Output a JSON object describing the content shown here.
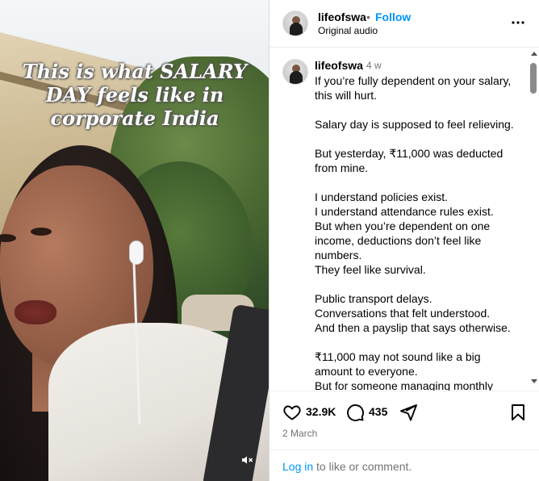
{
  "media": {
    "overlay_text": "This is what SALARY DAY feels like in corporate India",
    "mute_icon": "speaker-muted-icon"
  },
  "header": {
    "username": "lifeofswa",
    "separator": "•",
    "follow_label": "Follow",
    "audio": "Original audio",
    "more_icon": "more-horizontal-icon"
  },
  "caption": {
    "username": "lifeofswa",
    "time": "4 w",
    "text": "If you’re fully dependent on your salary,\nthis will hurt.\n\nSalary day is supposed to feel relieving.\n\nBut yesterday, ₹11,000 was deducted\nfrom mine.\n\nI understand policies exist.\nI understand attendance rules exist.\nBut when you’re dependent on one\nincome, deductions don’t feel like\nnumbers.\nThey feel like survival.\n\nPublic transport delays.\nConversations that felt understood.\nAnd then a payslip that says otherwise.\n\n₹11,000 may not sound like a big\namount to everyone.\nBut for someone managing monthly"
  },
  "actions": {
    "likes": "32.9K",
    "comments": "435",
    "date": "2 March",
    "login_link": "Log in",
    "login_rest": " to like or comment."
  },
  "colors": {
    "accent": "#0095f6",
    "muted": "#737373",
    "border": "#dbdbdb"
  }
}
